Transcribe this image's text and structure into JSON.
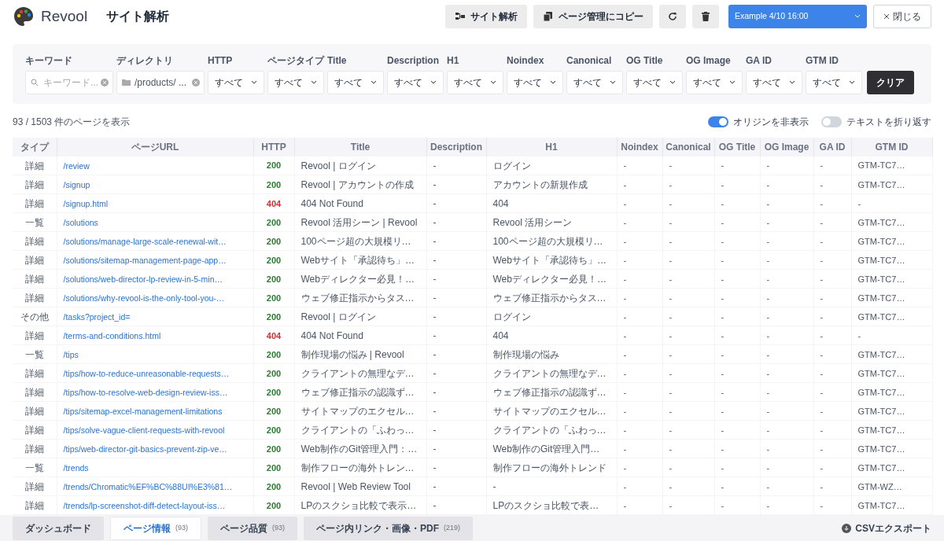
{
  "app": {
    "name": "Revool",
    "page_title": "サイト解析"
  },
  "toolbar": {
    "buttons": [
      {
        "kind": "sitemap",
        "label": "サイト解析"
      },
      {
        "kind": "copy",
        "label": "ページ管理にコピー"
      },
      {
        "kind": "refresh"
      },
      {
        "kind": "trash"
      }
    ],
    "snapshot": "Example 4/10 16:00",
    "close": "閉じる"
  },
  "filters": {
    "keyword": {
      "label": "キーワード",
      "placeholder": "キーワード..."
    },
    "directory": {
      "label": "ディレクトリ",
      "value": "/products/ ..."
    },
    "selects": [
      {
        "label": "HTTP",
        "value": "すべて"
      },
      {
        "label": "ページタイプ",
        "value": "すべて"
      },
      {
        "label": "Title",
        "value": "すべて"
      },
      {
        "label": "Description",
        "value": "すべて"
      },
      {
        "label": "H1",
        "value": "すべて"
      },
      {
        "label": "Noindex",
        "value": "すべて"
      },
      {
        "label": "Canonical",
        "value": "すべて"
      },
      {
        "label": "OG Title",
        "value": "すべて"
      },
      {
        "label": "OG Image",
        "value": "すべて"
      },
      {
        "label": "GA ID",
        "value": "すべて"
      },
      {
        "label": "GTM ID",
        "value": "すべて"
      }
    ],
    "clear": "クリア"
  },
  "summary": "93 / 1503 件のページを表示",
  "toggles": [
    {
      "label": "オリジンを非表示",
      "on": true
    },
    {
      "label": "テキストを折り返す",
      "on": false
    }
  ],
  "table": {
    "columns": [
      "タイプ",
      "ページURL",
      "HTTP",
      "Title",
      "Description",
      "H1",
      "Noindex",
      "Canonical",
      "OG Title",
      "OG Image",
      "GA ID",
      "GTM ID"
    ],
    "rows": [
      {
        "cells": [
          "詳細",
          "/review",
          "200",
          "Revool | ログイン",
          "-",
          "ログイン",
          "-",
          "-",
          "-",
          "-",
          "-",
          "GTM-TC7…"
        ],
        "color": "#2e7d32"
      },
      {
        "cells": [
          "詳細",
          "/signup",
          "200",
          "Revool | アカウントの作成",
          "-",
          "アカウントの新規作成",
          "-",
          "-",
          "-",
          "-",
          "-",
          "GTM-TC7…"
        ],
        "color": "#2e7d32"
      },
      {
        "cells": [
          "詳細",
          "/signup.html",
          "404",
          "404 Not Found",
          "-",
          "404",
          "-",
          "-",
          "-",
          "-",
          "-",
          "-"
        ],
        "color": "#d32f2f"
      },
      {
        "cells": [
          "一覧",
          "/solutions",
          "200",
          "Revool 活用シーン | Revool",
          "-",
          "Revool 活用シーン",
          "-",
          "-",
          "-",
          "-",
          "-",
          "GTM-TC7…"
        ],
        "color": "#2e7d32"
      },
      {
        "cells": [
          "詳細",
          "/solutions/manage-large-scale-renewal-wit…",
          "200",
          "100ページ超の大規模リ…",
          "-",
          "100ページ超の大規模リ…",
          "-",
          "-",
          "-",
          "-",
          "-",
          "GTM-TC7…"
        ],
        "color": "#2e7d32"
      },
      {
        "cells": [
          "詳細",
          "/solutions/sitemap-management-page-app…",
          "200",
          "Webサイト「承認待ち」…",
          "-",
          "Webサイト「承認待ち」…",
          "-",
          "-",
          "-",
          "-",
          "-",
          "GTM-TC7…"
        ],
        "color": "#2e7d32"
      },
      {
        "cells": [
          "詳細",
          "/solutions/web-director-lp-review-in-5-min…",
          "200",
          "Webディレクター必見！…",
          "-",
          "Webディレクター必見！…",
          "-",
          "-",
          "-",
          "-",
          "-",
          "GTM-TC7…"
        ],
        "color": "#2e7d32"
      },
      {
        "cells": [
          "詳細",
          "/solutions/why-revool-is-the-only-tool-you-…",
          "200",
          "ウェブ修正指示からタス…",
          "-",
          "ウェブ修正指示からタス…",
          "-",
          "-",
          "-",
          "-",
          "-",
          "GTM-TC7…"
        ],
        "color": "#2e7d32"
      },
      {
        "cells": [
          "その他",
          "/tasks?project_id=",
          "200",
          "Revool | ログイン",
          "-",
          "ログイン",
          "-",
          "-",
          "-",
          "-",
          "-",
          "GTM-TC7…"
        ],
        "color": "#2e7d32"
      },
      {
        "cells": [
          "詳細",
          "/terms-and-conditions.html",
          "404",
          "404 Not Found",
          "-",
          "404",
          "-",
          "-",
          "-",
          "-",
          "-",
          "-"
        ],
        "color": "#d32f2f"
      },
      {
        "cells": [
          "一覧",
          "/tips",
          "200",
          "制作現場の悩み | Revool",
          "-",
          "制作現場の悩み",
          "-",
          "-",
          "-",
          "-",
          "-",
          "GTM-TC7…"
        ],
        "color": "#2e7d32"
      },
      {
        "cells": [
          "詳細",
          "/tips/how-to-reduce-unreasonable-requests…",
          "200",
          "クライアントの無理なデ…",
          "-",
          "クライアントの無理なデ…",
          "-",
          "-",
          "-",
          "-",
          "-",
          "GTM-TC7…"
        ],
        "color": "#2e7d32"
      },
      {
        "cells": [
          "詳細",
          "/tips/how-to-resolve-web-design-review-iss…",
          "200",
          "ウェブ修正指示の認識ず…",
          "-",
          "ウェブ修正指示の認識ず…",
          "-",
          "-",
          "-",
          "-",
          "-",
          "GTM-TC7…"
        ],
        "color": "#2e7d32"
      },
      {
        "cells": [
          "詳細",
          "/tips/sitemap-excel-management-limitations",
          "200",
          "サイトマップのエクセル…",
          "-",
          "サイトマップのエクセル…",
          "-",
          "-",
          "-",
          "-",
          "-",
          "GTM-TC7…"
        ],
        "color": "#2e7d32"
      },
      {
        "cells": [
          "詳細",
          "/tips/solve-vague-client-requests-with-revool",
          "200",
          "クライアントの「ふわっ…",
          "-",
          "クライアントの「ふわっ…",
          "-",
          "-",
          "-",
          "-",
          "-",
          "GTM-TC7…"
        ],
        "color": "#2e7d32"
      },
      {
        "cells": [
          "詳細",
          "/tips/web-director-git-basics-prevent-zip-ve…",
          "200",
          "Web制作のGit管理入門：…",
          "-",
          "Web制作のGit管理入門…",
          "-",
          "-",
          "-",
          "-",
          "-",
          "GTM-TC7…"
        ],
        "color": "#2e7d32"
      },
      {
        "cells": [
          "一覧",
          "/trends",
          "200",
          "制作フローの海外トレン…",
          "-",
          "制作フローの海外トレンド",
          "-",
          "-",
          "-",
          "-",
          "-",
          "GTM-TC7…"
        ],
        "color": "#2e7d32"
      },
      {
        "cells": [
          "詳細",
          "/trends/Chromatic%EF%BC%88UI%E3%81…",
          "200",
          "Revool | Web Review Tool",
          "-",
          "-",
          "-",
          "-",
          "-",
          "-",
          "-",
          "GTM-WZ…"
        ],
        "color": "#2e7d32"
      },
      {
        "cells": [
          "詳細",
          "/trends/lp-screenshot-diff-detect-layout-iss…",
          "200",
          "LPのスクショ比較で表示…",
          "-",
          "LPのスクショ比較で表…",
          "-",
          "-",
          "-",
          "-",
          "-",
          "GTM-TC7…"
        ],
        "color": "#2e7d32"
      }
    ]
  },
  "bottom_tabs": [
    {
      "label": "ダッシュボード",
      "selected": false
    },
    {
      "label": "ページ情報",
      "count": "(93)",
      "selected": true
    },
    {
      "label": "ページ品質",
      "count": "(93)",
      "selected": false
    },
    {
      "label": "ページ内リンク・画像・PDF",
      "count": "(219)",
      "selected": false
    }
  ],
  "export": "CSVエクスポート"
}
